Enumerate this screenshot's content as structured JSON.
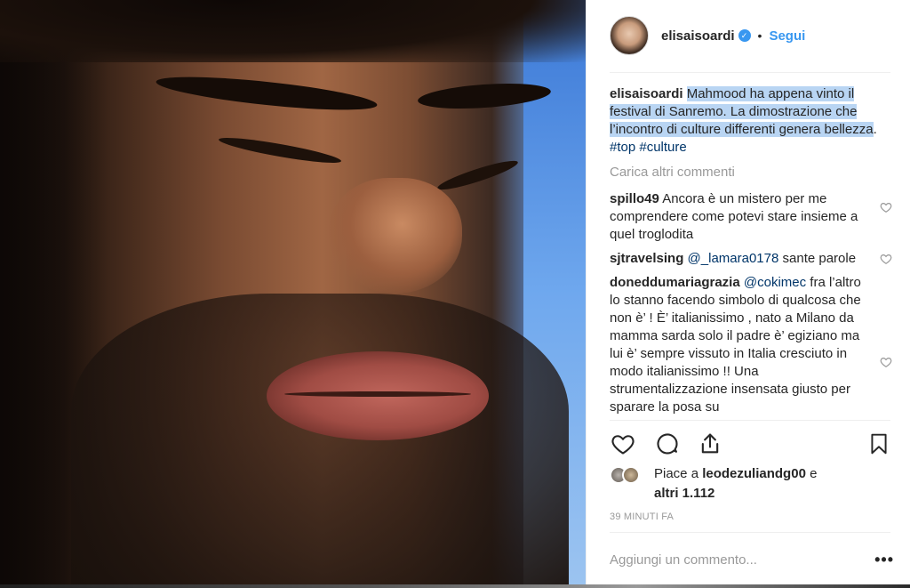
{
  "post": {
    "username": "elisaisoardi",
    "verified_icon": "verified-badge-icon",
    "separator": "•",
    "follow_label": "Segui"
  },
  "caption": {
    "username": "elisaisoardi",
    "text": "Mahmood ha appena vinto il festival di Sanremo. La dimostrazione che l’incontro di culture differenti genera bellezza",
    "trailing": ". ",
    "hashtags": [
      "#top",
      "#culture"
    ]
  },
  "load_more_label": "Carica altri commenti",
  "comments": [
    {
      "username": "spillo49",
      "mention": "",
      "text": "Ancora è un mistero per me comprendere come potevi stare insieme a quel troglodita"
    },
    {
      "username": "sjtravelsing",
      "mention": "@_lamara0178",
      "text": "sante parole"
    },
    {
      "username": "doneddumariagrazia",
      "mention": "@cokimec",
      "text": "fra l’altro lo stanno facendo simbolo di qualcosa che non è’ ! È’ italianissimo , nato a Milano da mamma sarda solo il padre è’ egiziano ma lui è’ sempre vissuto in Italia cresciuto in modo italianissimo !! Una strumentalizzazione insensata giusto per sparare la posa su"
    }
  ],
  "likes": {
    "prefix": "Piace a",
    "user": "leodezuliandg00",
    "joiner": "e",
    "others": "altri 1.112"
  },
  "timestamp": "39 MINUTI FA",
  "add_comment_placeholder": "Aggiungi un commento...",
  "more_options": "•••",
  "icons": {
    "like": "heart-icon",
    "comment": "comment-icon",
    "share": "share-icon",
    "save": "bookmark-icon"
  }
}
